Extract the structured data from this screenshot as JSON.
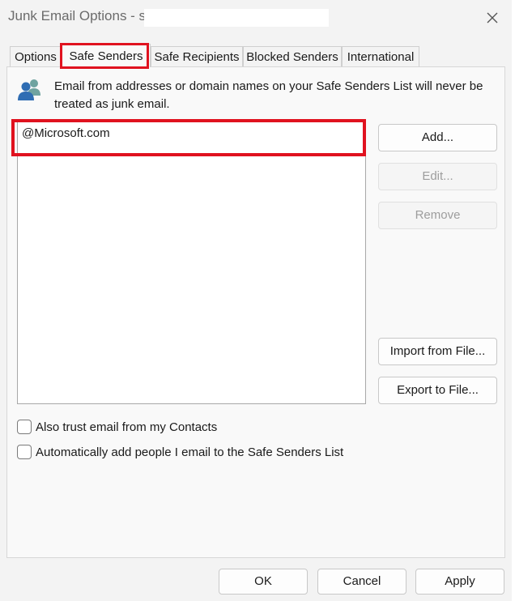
{
  "window": {
    "title": "Junk Email Options - s",
    "close_icon": "close-icon"
  },
  "tabs": [
    {
      "label": "Options",
      "active": false
    },
    {
      "label": "Safe Senders",
      "active": true
    },
    {
      "label": "Safe Recipients",
      "active": false
    },
    {
      "label": "Blocked Senders",
      "active": false
    },
    {
      "label": "International",
      "active": false
    }
  ],
  "panel": {
    "info_icon": "contacts-icon",
    "description": "Email from addresses or domain names on your Safe Senders List will never be treated as junk email.",
    "list_items": [
      "@Microsoft.com"
    ],
    "buttons": {
      "add": "Add...",
      "edit": "Edit...",
      "remove": "Remove",
      "import": "Import from File...",
      "export": "Export to File..."
    },
    "checkboxes": [
      {
        "label": "Also trust email from my Contacts",
        "checked": false
      },
      {
        "label": "Automatically add people I email to the Safe Senders List",
        "checked": false
      }
    ]
  },
  "footer": {
    "ok": "OK",
    "cancel": "Cancel",
    "apply": "Apply"
  },
  "colors": {
    "highlight": "#e0121f",
    "disabled_text": "#9d9d9d"
  }
}
